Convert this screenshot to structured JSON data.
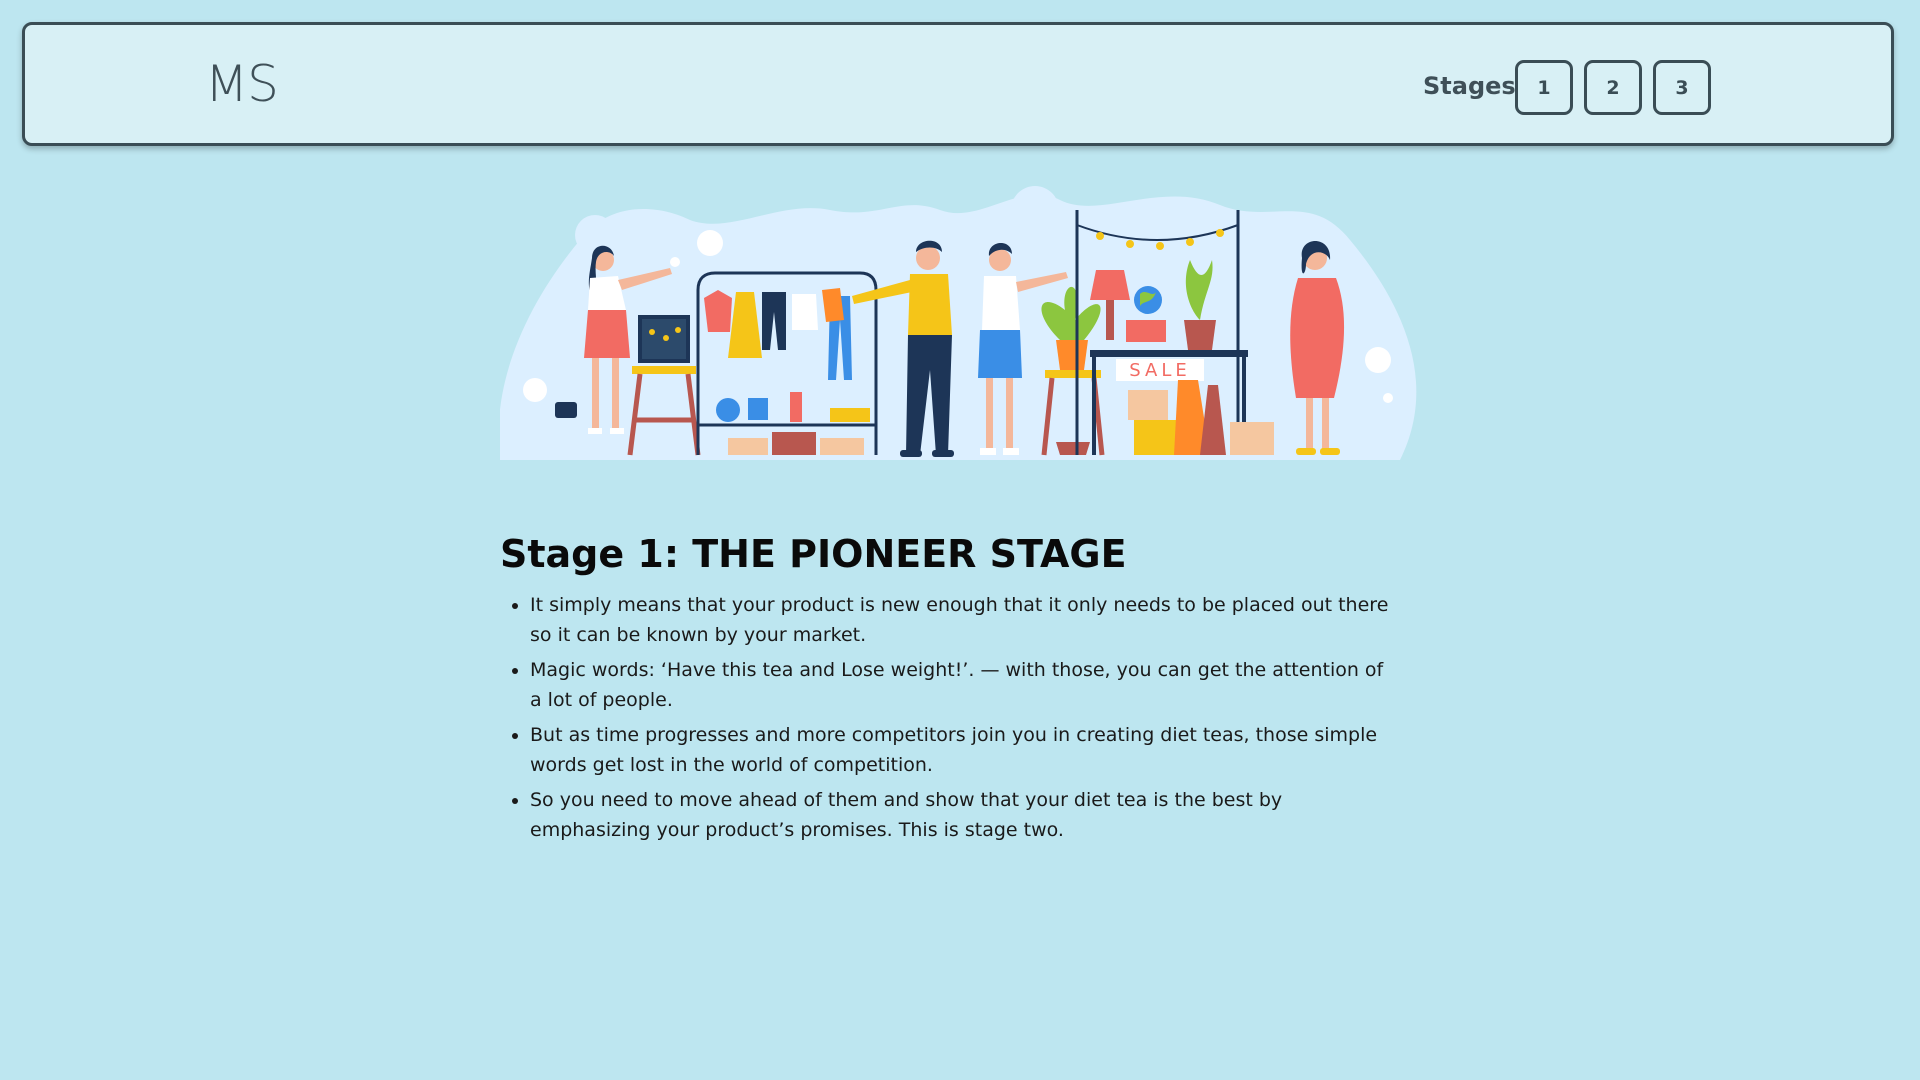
{
  "header": {
    "logo": "MS",
    "stages_label": "Stages",
    "stage_buttons": [
      "1",
      "2",
      "3"
    ]
  },
  "illustration": {
    "sale_sign": "SALE",
    "colors": {
      "blob": "#dcefff",
      "coral": "#f26b63",
      "yellow": "#f5c518",
      "navy": "#1d3557",
      "blue": "#3a8ee6"
    }
  },
  "main": {
    "title": "Stage 1: THE PIONEER STAGE",
    "points": [
      "It simply means that your product is new enough that it only needs to be placed out there so it can be known by your market.",
      "Magic words: ‘Have this tea and Lose weight!’. — with those, you can get the attention of a lot of people.",
      "But as time progresses and more competitors join you in creating diet teas, those simple words get lost in the world of competition.",
      "So you need to move ahead of them and show that your diet tea is the best by emphasizing your product’s promises. This is stage two."
    ]
  },
  "theme": {
    "page_bg": "#bde6f0",
    "header_bg": "#d8f0f5",
    "border": "#3a4d55"
  }
}
